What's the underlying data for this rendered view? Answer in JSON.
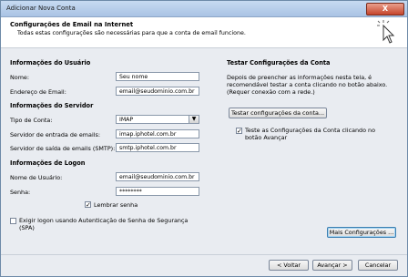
{
  "window": {
    "title": "Adicionar Nova Conta",
    "close_glyph": "X"
  },
  "header": {
    "title": "Configurações de Email na Internet",
    "subtitle": "Todas estas configurações são necessárias para que a conta de email funcione."
  },
  "user_info": {
    "section": "Informações do Usuário",
    "name_label": "Nome:",
    "name_value": "Seu nome",
    "email_label": "Endereço de Email:",
    "email_value": "email@seudominio.com.br"
  },
  "server_info": {
    "section": "Informações do Servidor",
    "account_type_label": "Tipo de Conta:",
    "account_type_value": "IMAP",
    "incoming_label": "Servidor de entrada de emails:",
    "incoming_value": "imap.iphotel.com.br",
    "outgoing_label": "Servidor de saída de emails (SMTP):",
    "outgoing_value": "smtp.iphotel.com.br"
  },
  "logon_info": {
    "section": "Informações de Logon",
    "username_label": "Nome de Usuário:",
    "username_value": "email@seudominio.com.br",
    "password_label": "Senha:",
    "password_value": "********",
    "remember_label": "Lembrar senha",
    "remember_checked": true,
    "spa_label_1": "Exigir logon usando Autenticação de Senha de Segurança",
    "spa_label_2": "(SPA)",
    "spa_checked": false
  },
  "test_settings": {
    "section": "Testar Configurações da Conta",
    "description_1": "Depois de preencher as informações nesta tela, é",
    "description_2": "recomendável testar a conta clicando no botão abaixo.",
    "description_3": "(Requer conexão com a rede.)",
    "test_button": "Testar configurações da conta...",
    "auto_test_label_1": "Teste as Configurações da Conta clicando no",
    "auto_test_label_2": "botão Avançar",
    "auto_test_checked": true
  },
  "buttons": {
    "more_settings": "Mais Configurações ...",
    "back": "< Voltar",
    "next": "Avançar >",
    "cancel": "Cancelar"
  },
  "check_glyph": "✓"
}
